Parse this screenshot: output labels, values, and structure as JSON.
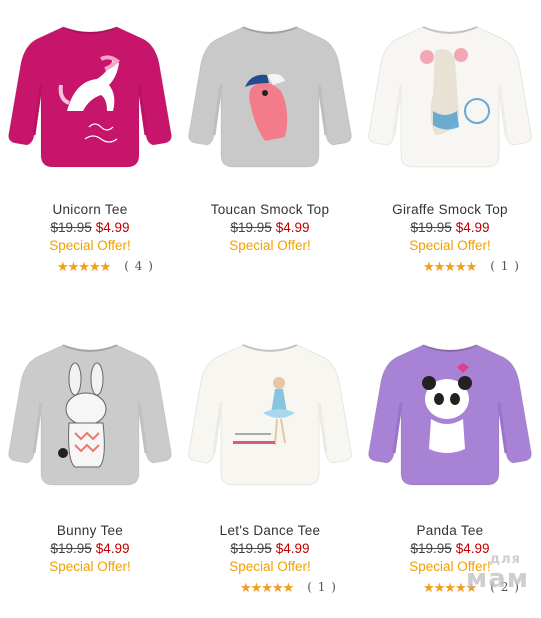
{
  "products": [
    {
      "name": "Unicorn Tee",
      "old_price": "$19.95",
      "new_price": "$4.99",
      "offer": "Special Offer!",
      "rating": 5,
      "review_count": "( 4 )",
      "shirt_color": "#c8156c",
      "sleeve_color": "#b81262",
      "art": "unicorn"
    },
    {
      "name": "Toucan Smock Top",
      "old_price": "$19.95",
      "new_price": "$4.99",
      "offer": "Special Offer!",
      "shirt_color": "#c9c9c9",
      "sleeve_color": "#bdbdbd",
      "art": "toucan"
    },
    {
      "name": "Giraffe Smock Top",
      "old_price": "$19.95",
      "new_price": "$4.99",
      "offer": "Special Offer!",
      "rating": 5,
      "review_count": "( 1 )",
      "shirt_color": "#f7f6f2",
      "sleeve_color": "#eeede8",
      "art": "giraffe"
    },
    {
      "name": "Bunny Tee",
      "old_price": "$19.95",
      "new_price": "$4.99",
      "offer": "Special Offer!",
      "shirt_color": "#cbcbcb",
      "sleeve_color": "#c0c0c0",
      "art": "bunny"
    },
    {
      "name": "Let's Dance Tee",
      "old_price": "$19.95",
      "new_price": "$4.99",
      "offer": "Special Offer!",
      "rating": 5,
      "review_count": "( 1 )",
      "shirt_color": "#f7f6f1",
      "sleeve_color": "#eceae4",
      "art": "dance"
    },
    {
      "name": "Panda Tee",
      "old_price": "$19.95",
      "new_price": "$4.99",
      "offer": "Special Offer!",
      "rating": 5,
      "review_count": "( 2 )",
      "shirt_color": "#a882d4",
      "sleeve_color": "#9a74c8",
      "art": "panda"
    }
  ],
  "watermark": {
    "line1": "для",
    "line2": "мам"
  },
  "colors": {
    "old_price": "#444444",
    "new_price": "#c00000",
    "offer": "#f0a000",
    "star": "#f2a01c"
  }
}
